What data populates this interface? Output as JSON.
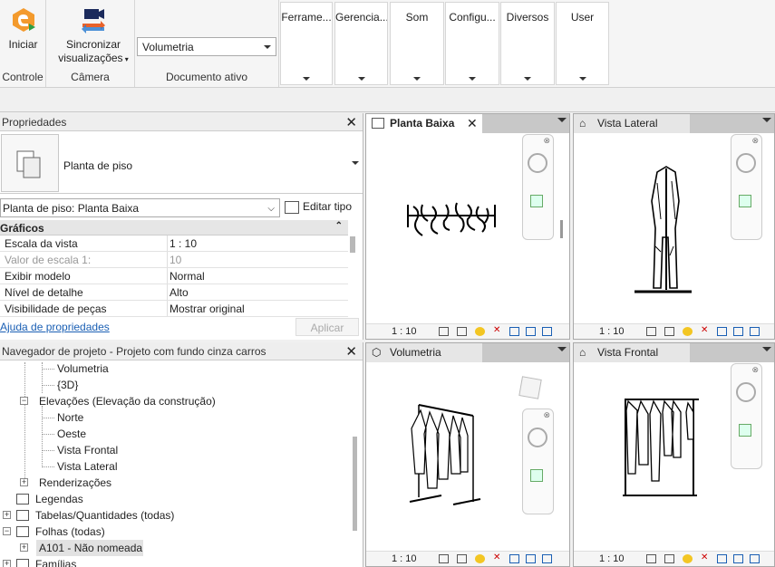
{
  "ribbon": {
    "iniciar_label": "Iniciar",
    "controle_label": "Controle",
    "sync_label_line1": "Sincronizar",
    "sync_label_line2": "visualizações",
    "camera_label": "Câmera",
    "doc_select_value": "Volumetria",
    "doc_ativo_label": "Documento ativo",
    "tabs": [
      "Ferrame...",
      "Gerencia...",
      "Som",
      "Configu...",
      "Diversos",
      "User"
    ]
  },
  "properties": {
    "title": "Propriedades",
    "type_name": "Planta de piso",
    "instance_select": "Planta de piso: Planta Baixa",
    "edit_type_label": "Editar tipo",
    "group_label": "Gráficos",
    "rows": [
      {
        "key": "Escala da vista",
        "value": "1 : 10"
      },
      {
        "key": "Valor de escala    1:",
        "value": "10"
      },
      {
        "key": "Exibir modelo",
        "value": "Normal"
      },
      {
        "key": "Nível de detalhe",
        "value": "Alto"
      },
      {
        "key": "Visibilidade de peças",
        "value": "Mostrar original"
      }
    ],
    "help_link": "Ajuda de propriedades",
    "apply_label": "Aplicar"
  },
  "navigator": {
    "title": "Navegador de projeto - Projeto com fundo cinza carros",
    "items": [
      "Volumetria",
      "{3D}",
      "Elevações (Elevação da construção)",
      "Norte",
      "Oeste",
      "Vista Frontal",
      "Vista Lateral",
      "Renderizações",
      "Legendas",
      "Tabelas/Quantidades (todas)",
      "Folhas (todas)",
      "A101 - Não nomeada",
      "Famílias"
    ]
  },
  "views": {
    "planta": {
      "title": "Planta Baixa",
      "scale": "1 : 10"
    },
    "lateral": {
      "title": "Vista Lateral",
      "scale": "1 : 10"
    },
    "volumetria": {
      "title": "Volumetria",
      "scale": "1 : 10"
    },
    "frontal": {
      "title": "Vista Frontal",
      "scale": "1 : 10"
    }
  },
  "colors": {
    "accent": "#e87722",
    "ribbon_bg": "#f5f5f5",
    "tab_inactive": "#c8c8c8",
    "link": "#1a5fb4"
  }
}
